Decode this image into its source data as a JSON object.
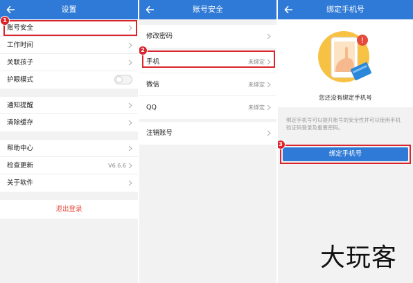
{
  "panel1": {
    "title": "设置",
    "items": [
      {
        "label": "账号安全"
      },
      {
        "label": "工作时间"
      },
      {
        "label": "关联孩子"
      },
      {
        "label": "护眼模式"
      },
      {
        "label": "通知提醒"
      },
      {
        "label": "清除缓存"
      },
      {
        "label": "帮助中心"
      },
      {
        "label": "检查更新",
        "value": "V6.6.6"
      },
      {
        "label": "关于软件"
      }
    ],
    "logout": "退出登录",
    "step": "1"
  },
  "panel2": {
    "title": "账号安全",
    "items": [
      {
        "label": "修改密码"
      },
      {
        "label": "手机",
        "value": "未绑定"
      },
      {
        "label": "微信",
        "value": "未绑定"
      },
      {
        "label": "QQ",
        "value": "未绑定"
      },
      {
        "label": "注销账号"
      }
    ],
    "step": "2"
  },
  "panel3": {
    "title": "绑定手机号",
    "empty_text": "您还没有绑定手机号",
    "description": "绑定手机号可以提升账号的安全性并可以使用手机验证码登录及重置密码。",
    "button": "绑定手机号",
    "alert_glyph": "!",
    "step": "3"
  },
  "watermark": "大玩客",
  "colors": {
    "header": "#2f7ad6",
    "highlight": "#d9252b",
    "logout": "#e64a3b",
    "illustration_circle": "#f7c244",
    "card_blue": "#2b87d9"
  }
}
